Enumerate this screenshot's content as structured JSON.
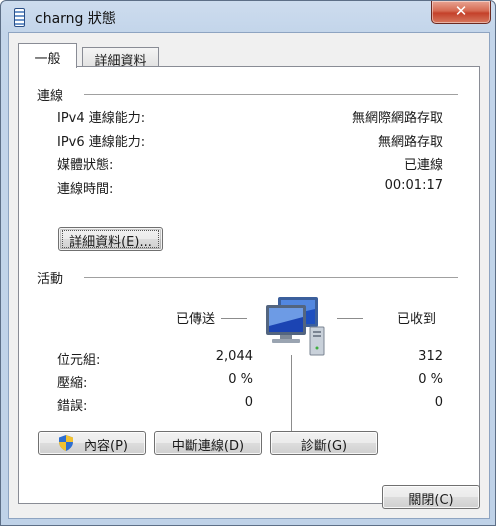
{
  "window": {
    "title": "charng 狀態",
    "close_glyph": "✕"
  },
  "tabs": [
    {
      "label": "一般"
    },
    {
      "label": "詳細資料"
    }
  ],
  "connection": {
    "heading": "連線",
    "rows": [
      {
        "label": "IPv4 連線能力:",
        "value": "無網際網路存取"
      },
      {
        "label": "IPv6 連線能力:",
        "value": "無網路存取"
      },
      {
        "label": "媒體狀態:",
        "value": "已連線"
      },
      {
        "label": "連線時間:",
        "value": "00:01:17"
      }
    ],
    "details_button": "詳細資料(E)..."
  },
  "activity": {
    "heading": "活動",
    "sent_label": "已傳送",
    "received_label": "已收到",
    "rows": [
      {
        "label": "位元組:",
        "sent": "2,044",
        "received": "312"
      },
      {
        "label": "壓縮:",
        "sent": "0 %",
        "received": "0 %"
      },
      {
        "label": "錯誤:",
        "sent": "0",
        "received": "0"
      }
    ]
  },
  "buttons": {
    "properties": "內容(P)",
    "disable": "中斷連線(D)",
    "diagnose": "診斷(G)",
    "close": "關閉(C)"
  },
  "icons": {
    "app": "network-status-icon",
    "shield": "uac-shield-icon",
    "network": "network-computers-icon"
  }
}
